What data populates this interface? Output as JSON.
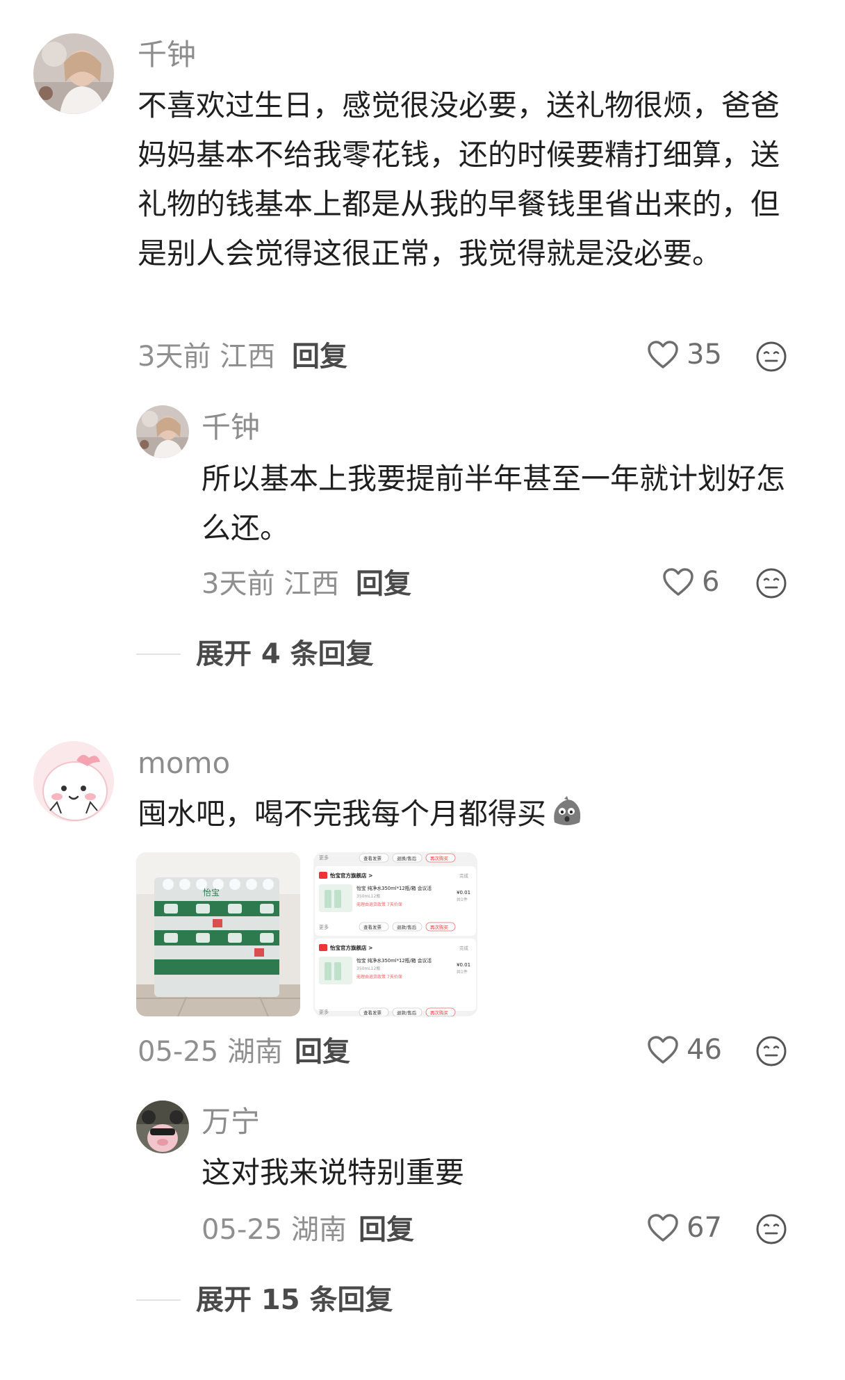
{
  "comments": [
    {
      "author": "千钟",
      "text": "不喜欢过生日，感觉很没必要，送礼物很烦，爸爸妈妈基本不给我零花钱，还的时候要精打细算，送礼物的钱基本上都是从我的早餐钱里省出来的，但是别人会觉得这很正常，我觉得就是没必要。",
      "meta": "3天前 江西",
      "reply_label": "回复",
      "likes": "35",
      "replies": [
        {
          "author": "千钟",
          "text": "所以基本上我要提前半年甚至一年就计划好怎么还。",
          "meta": "3天前 江西",
          "reply_label": "回复",
          "likes": "6"
        }
      ],
      "expand_label": "展开 4 条回复"
    },
    {
      "author": "momo",
      "text": "囤水吧，喝不完我每个月都得买",
      "meta": "05-25 湖南",
      "reply_label": "回复",
      "likes": "46",
      "images": {
        "photo_brand": "怡宝",
        "order_list": [
          {
            "top_buttons": [
              "更多",
              "查看发票",
              "退换/售后",
              "再次购买"
            ],
            "shop": "怡宝官方旗舰店 >",
            "status": "完成",
            "product": "怡宝 纯净水350ml*12瓶/箱 会议活",
            "spec": "350mL12瓶",
            "tags": "无理由退货政策  7天价保",
            "price": "¥0.01",
            "qty": "共1件"
          },
          {
            "top_buttons": [
              "更多",
              "查看发票",
              "退款/售后",
              "再次购买"
            ],
            "shop": "怡宝官方旗舰店 >",
            "status": "完成",
            "product": "怡宝 纯净水350ml*12瓶/箱 会议活",
            "spec": "350mL12瓶",
            "tags": "无理由退货政策  7天价保",
            "price": "¥0.01",
            "qty": "共1件"
          }
        ],
        "bottom_buttons": [
          "更多",
          "查看发票",
          "退款/售后",
          "再次购买"
        ]
      },
      "replies": [
        {
          "author": "万宁",
          "text": "这对我来说特别重要",
          "meta": "05-25 湖南",
          "reply_label": "回复",
          "likes": "67"
        }
      ],
      "expand_label": "展开 15 条回复"
    }
  ],
  "icons": {
    "like": "heart-outline-icon",
    "emoji": "neutral-face-icon",
    "inline": "rock-face-emoji"
  },
  "colors": {
    "name": "#8c8c8c",
    "body": "#1f1f1f",
    "meta": "#8f8f8f",
    "action": "#4a4a4a"
  }
}
